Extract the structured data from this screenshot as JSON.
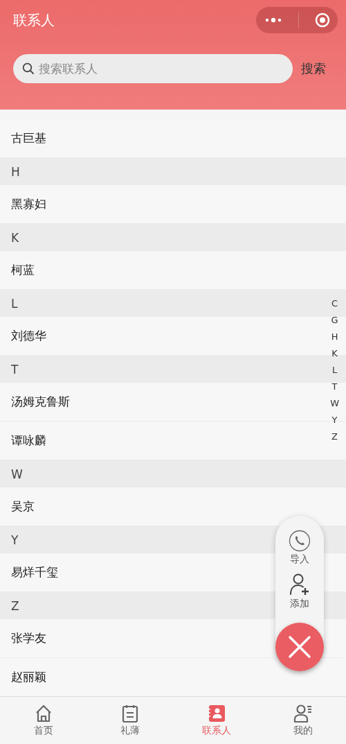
{
  "header": {
    "title": "联系人"
  },
  "search": {
    "placeholder": "搜索联系人",
    "button": "搜索"
  },
  "list": [
    {
      "kind": "contact",
      "text": "古巨基"
    },
    {
      "kind": "section",
      "text": "H"
    },
    {
      "kind": "contact",
      "text": "黑寡妇"
    },
    {
      "kind": "section",
      "text": "K"
    },
    {
      "kind": "contact",
      "text": "柯蓝"
    },
    {
      "kind": "section",
      "text": "L"
    },
    {
      "kind": "contact",
      "text": "刘德华"
    },
    {
      "kind": "section",
      "text": "T"
    },
    {
      "kind": "contact",
      "text": "汤姆克鲁斯"
    },
    {
      "kind": "contact",
      "text": "谭咏麟"
    },
    {
      "kind": "section",
      "text": "W"
    },
    {
      "kind": "contact",
      "text": "吴京"
    },
    {
      "kind": "section",
      "text": "Y"
    },
    {
      "kind": "contact",
      "text": "易烊千玺"
    },
    {
      "kind": "section",
      "text": "Z"
    },
    {
      "kind": "contact",
      "text": "张学友"
    },
    {
      "kind": "contact",
      "text": "赵丽颖"
    }
  ],
  "index": [
    "C",
    "G",
    "H",
    "K",
    "L",
    "T",
    "W",
    "Y",
    "Z"
  ],
  "fab_menu": [
    {
      "kind": "import",
      "label": "导入"
    },
    {
      "kind": "add",
      "label": "添加"
    }
  ],
  "tabs": [
    {
      "kind": "home",
      "label": "首页",
      "selected": false
    },
    {
      "kind": "book",
      "label": "礼薄",
      "selected": false
    },
    {
      "kind": "contacts",
      "label": "联系人",
      "selected": true
    },
    {
      "kind": "me",
      "label": "我的",
      "selected": false
    }
  ]
}
